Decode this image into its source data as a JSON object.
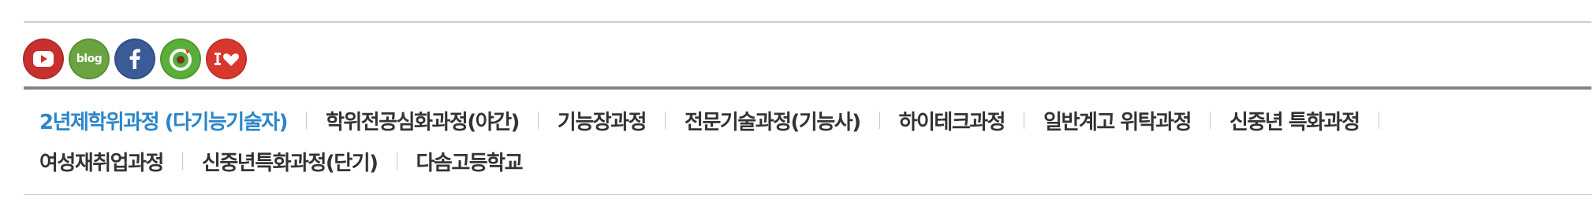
{
  "social": [
    {
      "name": "youtube",
      "icon": "youtube-icon",
      "color": "#c8302f"
    },
    {
      "name": "blog",
      "icon": "blog-icon",
      "color": "#6aa340",
      "label": "blog"
    },
    {
      "name": "facebook",
      "icon": "facebook-icon",
      "color": "#3a5a98"
    },
    {
      "name": "story",
      "icon": "story-icon",
      "color": "#5aae3a"
    },
    {
      "name": "ilove",
      "icon": "ilove-icon",
      "color": "#d9372d"
    }
  ],
  "nav": {
    "active_color": "#2b86c9",
    "row1": [
      "2년제학위과정 (다기능기술자)",
      "학위전공심화과정(야간)",
      "기능장과정",
      "전문기술과정(기능사)",
      "하이테크과정",
      "일반계고 위탁과정",
      "신중년 특화과정"
    ],
    "row2": [
      "여성재취업과정",
      "신중년특화과정(단기)",
      "다솜고등학교"
    ]
  }
}
